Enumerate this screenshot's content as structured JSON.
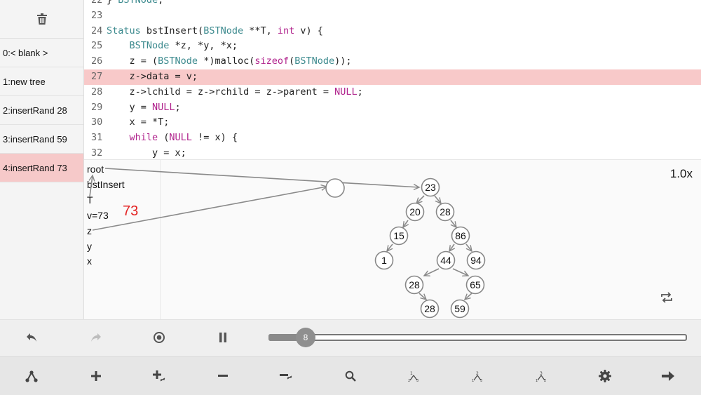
{
  "history": [
    {
      "label": "0:< blank >"
    },
    {
      "label": "1:new tree"
    },
    {
      "label": "2:insertRand 28"
    },
    {
      "label": "3:insertRand 59"
    },
    {
      "label": "4:insertRand 73",
      "active": true
    }
  ],
  "code": {
    "highlight_line": 27,
    "lines": [
      {
        "n": "22",
        "html": "} <span class=\"ty\">BSTNode</span>;"
      },
      {
        "n": "23",
        "html": ""
      },
      {
        "n": "24",
        "html": "<span class=\"ty\">Status</span> bstInsert(<span class=\"ty\">BSTNode</span> **T, <span class=\"kw\">int</span> v) {"
      },
      {
        "n": "25",
        "html": "    <span class=\"ty\">BSTNode</span> *z, *y, *x;"
      },
      {
        "n": "26",
        "html": "    z = (<span class=\"ty\">BSTNode</span> *)malloc(<span class=\"kw\">sizeof</span>(<span class=\"ty\">BSTNode</span>));"
      },
      {
        "n": "27",
        "html": "    z->data = v;"
      },
      {
        "n": "28",
        "html": "    z->lchild = z->rchild = z->parent = <span class=\"kw\">NULL</span>;"
      },
      {
        "n": "29",
        "html": "    y = <span class=\"kw\">NULL</span>;"
      },
      {
        "n": "30",
        "html": "    x = *T;"
      },
      {
        "n": "31",
        "html": "    <span class=\"kw\">while</span> (<span class=\"kw\">NULL</span> != x) {"
      },
      {
        "n": "32",
        "html": "        y = x;"
      }
    ]
  },
  "viz": {
    "zoom": "1.0x",
    "variables": [
      "root",
      "bstInsert",
      "T",
      "v=73",
      "z",
      "y",
      "x"
    ],
    "arg_value": "73",
    "nodes": [
      "23",
      "20",
      "28",
      "15",
      "86",
      "1",
      "44",
      "94",
      "28",
      "65",
      "28",
      "59"
    ]
  },
  "slider": {
    "value": "8"
  },
  "colors": {
    "highlight": "#f8c9c9",
    "keyword": "#b0228c",
    "type": "#3c8a8e",
    "arg_value": "#e32222"
  }
}
